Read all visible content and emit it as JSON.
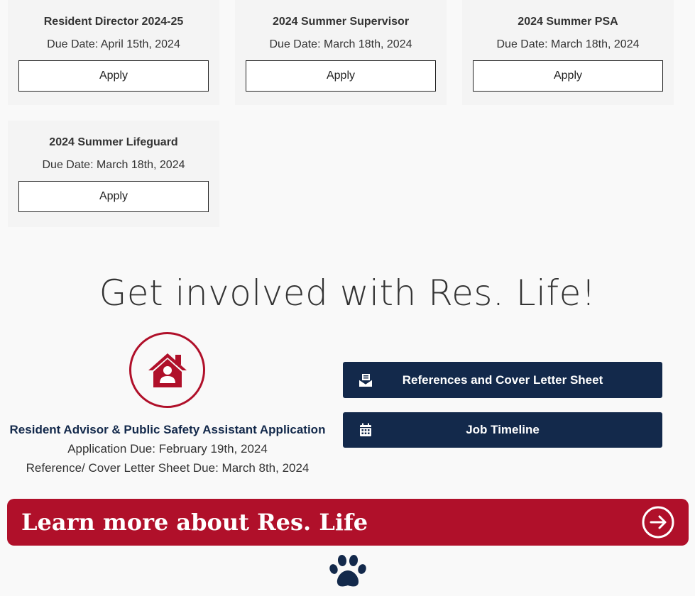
{
  "jobs": [
    {
      "title": "Resident Director 2024-25",
      "due": "Due Date: April 15th, 2024",
      "apply": "Apply"
    },
    {
      "title": "2024 Summer Supervisor",
      "due": "Due Date: March 18th, 2024",
      "apply": "Apply"
    },
    {
      "title": "2024 Summer PSA",
      "due": "Due Date: March 18th, 2024",
      "apply": "Apply"
    },
    {
      "title": "2024 Summer Lifeguard",
      "due": "Due Date: March 18th, 2024",
      "apply": "Apply"
    }
  ],
  "involved": {
    "heading": "Get involved with Res. Life!",
    "ra_title": "Resident Advisor & Public Safety Assistant Application",
    "ra_due": "Application Due: February 19th, 2024",
    "ra_ref_due": "Reference/ Cover Letter Sheet Due: March 8th, 2024",
    "icon": "house-user-icon"
  },
  "buttons": {
    "references": {
      "label": "References and Cover Letter Sheet",
      "icon": "envelope-open-icon"
    },
    "timeline": {
      "label": "Job Timeline",
      "icon": "calendar-icon"
    }
  },
  "banner": {
    "label": "Learn more about Res. Life",
    "icon": "arrow-right-circle-icon"
  },
  "footer": {
    "icon": "paw-icon"
  },
  "colors": {
    "navy": "#13294b",
    "crimson": "#b0102a",
    "card_bg": "#f4f4f4"
  }
}
